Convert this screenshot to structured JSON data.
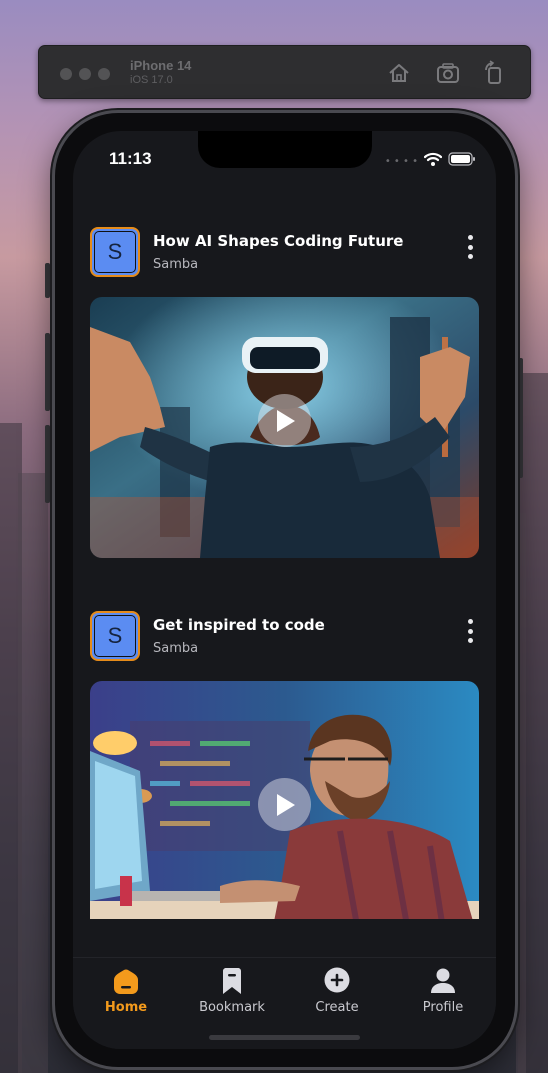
{
  "simulator": {
    "device_name": "iPhone 14",
    "os_version": "iOS 17.0",
    "buttons": [
      "home-icon",
      "screenshot-icon",
      "rotate-icon"
    ]
  },
  "status_bar": {
    "time": "11:13",
    "icons": [
      "cellular-icon",
      "wifi-icon",
      "battery-icon"
    ]
  },
  "posts": [
    {
      "avatar_letter": "S",
      "title": "How AI Shapes Coding Future",
      "author": "Samba",
      "media": "video"
    },
    {
      "avatar_letter": "S",
      "title": "Get inspired to code",
      "author": "Samba",
      "media": "video"
    }
  ],
  "tabbar": {
    "active": "Home",
    "items": [
      {
        "label": "Home",
        "icon": "home-icon"
      },
      {
        "label": "Bookmark",
        "icon": "bookmark-icon"
      },
      {
        "label": "Create",
        "icon": "plus-circle-icon"
      },
      {
        "label": "Profile",
        "icon": "profile-icon"
      }
    ]
  },
  "colors": {
    "accent": "#f39a1c",
    "background": "#17181c",
    "avatar": "#5b8cf2"
  }
}
